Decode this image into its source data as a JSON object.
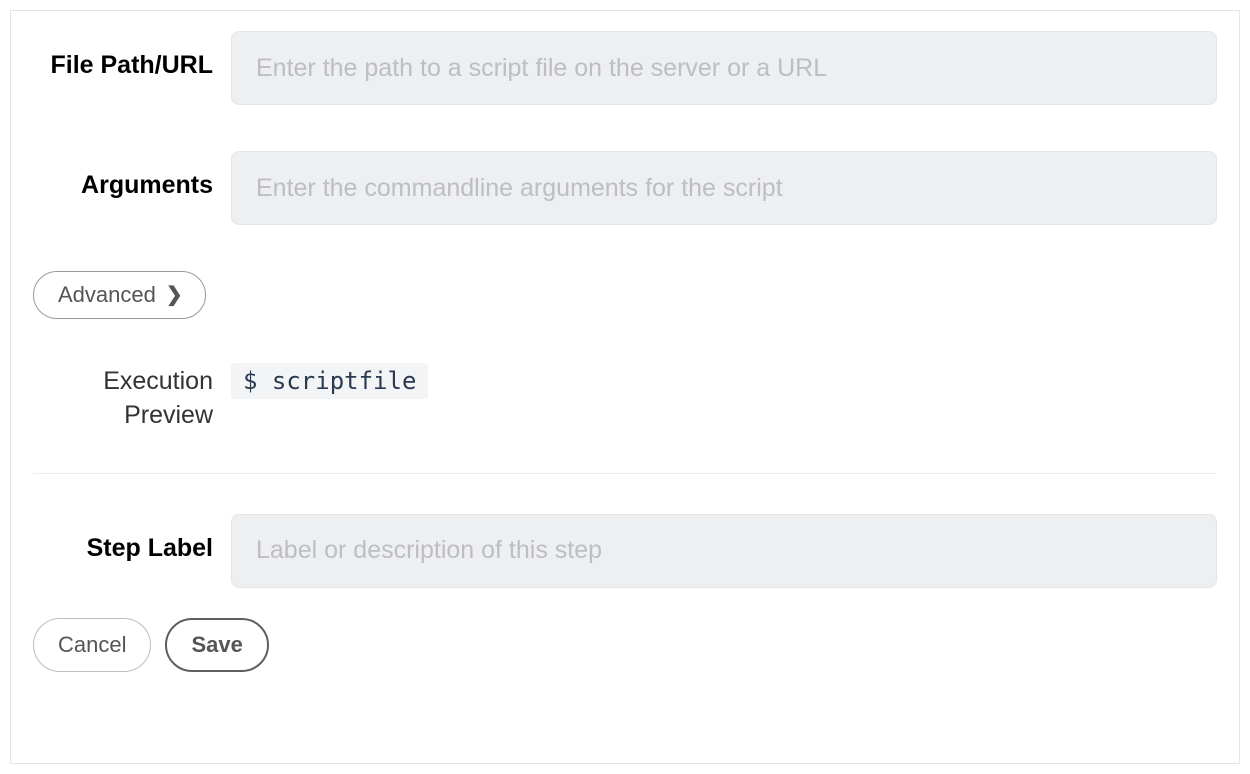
{
  "fields": {
    "file_path": {
      "label": "File Path/URL",
      "placeholder": "Enter the path to a script file on the server or a URL",
      "value": ""
    },
    "arguments": {
      "label": "Arguments",
      "placeholder": "Enter the commandline arguments for the script",
      "value": ""
    },
    "step_label": {
      "label": "Step Label",
      "placeholder": "Label or description of this step",
      "value": ""
    }
  },
  "advanced_button": "Advanced",
  "execution_preview": {
    "label": "Execution Preview",
    "code": "$ scriptfile"
  },
  "buttons": {
    "cancel": "Cancel",
    "save": "Save"
  }
}
